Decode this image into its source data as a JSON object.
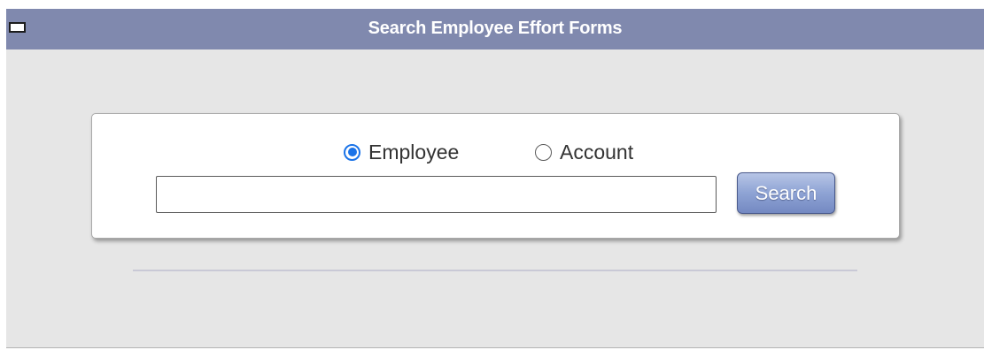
{
  "panel": {
    "title": "Search Employee Effort Forms"
  },
  "search": {
    "options": [
      {
        "label": "Employee",
        "checked": true
      },
      {
        "label": "Account",
        "checked": false
      }
    ],
    "input_value": "",
    "button_label": "Search"
  },
  "colors": {
    "titlebar_bg": "#8089ae",
    "panel_bg": "#e6e6e6",
    "radio_accent": "#1a73e8",
    "button_top": "#b7c5e6",
    "button_bottom": "#7489c2"
  }
}
